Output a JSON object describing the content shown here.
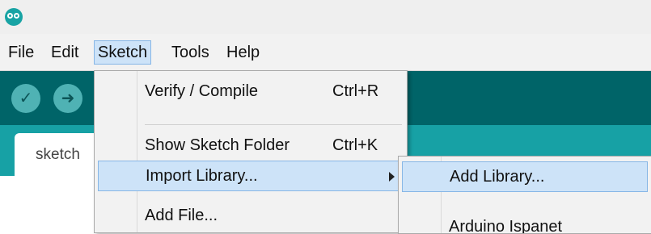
{
  "app": {
    "logo_icon": "arduino-logo-icon"
  },
  "menubar": {
    "items": [
      {
        "label": "File"
      },
      {
        "label": "Edit"
      },
      {
        "label": "Sketch"
      },
      {
        "label": "Tools"
      },
      {
        "label": "Help"
      }
    ],
    "active": "Sketch"
  },
  "toolbar": {
    "verify_icon": "checkmark-icon",
    "upload_icon": "right-arrow-icon",
    "verify_glyph": "✓",
    "upload_glyph": "➜"
  },
  "tabs": {
    "active_tab": "sketch"
  },
  "sketch_menu": {
    "items": [
      {
        "label": "Verify / Compile",
        "shortcut": "Ctrl+R"
      },
      {
        "label": "Show Sketch Folder",
        "shortcut": "Ctrl+K"
      },
      {
        "label": "Import Library...",
        "has_submenu": true,
        "highlighted": true
      },
      {
        "label": "Add File..."
      }
    ]
  },
  "import_submenu": {
    "items": [
      {
        "label": "Add Library...",
        "highlighted": true
      },
      {
        "label": "Arduino Ispanet"
      }
    ]
  },
  "colors": {
    "toolbar": "#006468",
    "tabstrip": "#17a1a5",
    "menu_highlight": "#cde3f8",
    "menu_highlight_border": "#86b6e6"
  }
}
